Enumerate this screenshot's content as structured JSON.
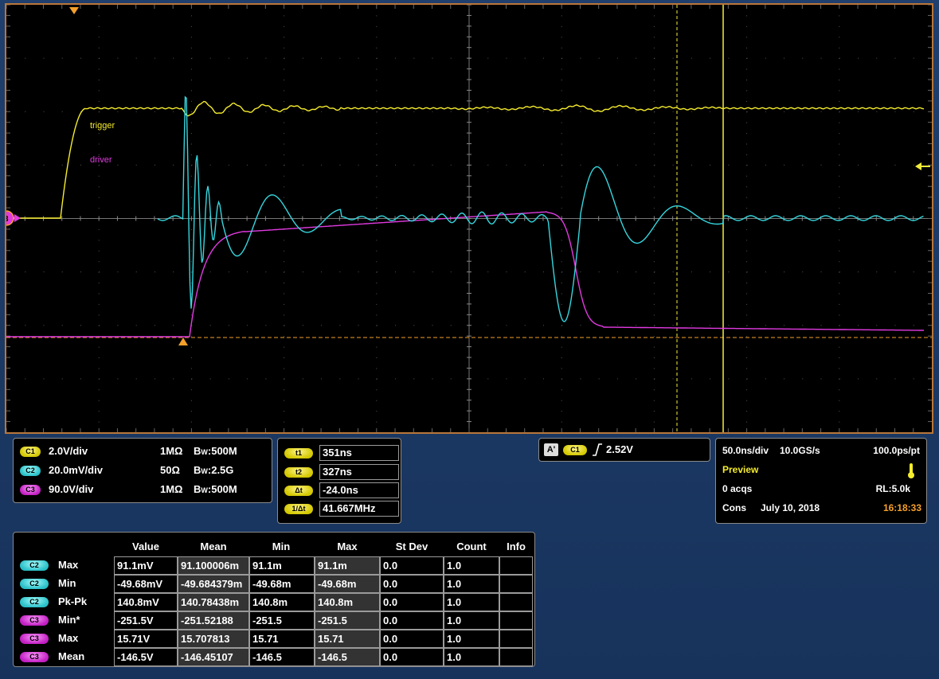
{
  "colors": {
    "ch1": "#f5ec2c",
    "ch2": "#35d6de",
    "ch3": "#e23ae2",
    "accent_orange": "#f5a02a",
    "cursor_line": "#f4ec3a"
  },
  "waveform_labels": {
    "ch1": "trigger",
    "ch3": "driver",
    "ground_marker": "3"
  },
  "vertical": [
    {
      "channel": "C1",
      "scale": "2.0V/div",
      "impedance": "1MΩ",
      "bw_b": "B",
      "bw_w": "W",
      "bw_value": ":500M"
    },
    {
      "channel": "C2",
      "scale": "20.0mV/div",
      "impedance": "50Ω",
      "bw_b": "B",
      "bw_w": "W",
      "bw_value": ":2.5G"
    },
    {
      "channel": "C3",
      "scale": "90.0V/div",
      "impedance": "1MΩ",
      "bw_b": "B",
      "bw_w": "W",
      "bw_value": ":500M"
    }
  ],
  "cursors": [
    {
      "label": "t1",
      "value": "351ns"
    },
    {
      "label": "t2",
      "value": "327ns"
    },
    {
      "label": "Δt",
      "value": "-24.0ns"
    },
    {
      "label": "1/Δt",
      "value": "41.667MHz"
    }
  ],
  "trigger": {
    "mode_badge": "A'",
    "source": "C1",
    "slope_icon": "rising-edge-icon",
    "level": "2.52V"
  },
  "acquisition": {
    "timebase": "50.0ns/div",
    "sample_rate": "10.0GS/s",
    "resolution": "100.0ps/pt",
    "state": "Preview",
    "acqs": "0 acqs",
    "record_length": "RL:5.0k",
    "cons": "Cons",
    "date": "July 10, 2018",
    "time": "16:18:33"
  },
  "measurements": {
    "headers": [
      "Value",
      "Mean",
      "Min",
      "Max",
      "St Dev",
      "Count",
      "Info"
    ],
    "rows": [
      {
        "channel": "C2",
        "name": "Max",
        "cells": [
          "91.1mV",
          "91.100006m",
          "91.1m",
          "91.1m",
          "0.0",
          "1.0",
          ""
        ]
      },
      {
        "channel": "C2",
        "name": "Min",
        "cells": [
          "-49.68mV",
          "-49.684379m",
          "-49.68m",
          "-49.68m",
          "0.0",
          "1.0",
          ""
        ]
      },
      {
        "channel": "C2",
        "name": "Pk-Pk",
        "cells": [
          "140.8mV",
          "140.78438m",
          "140.8m",
          "140.8m",
          "0.0",
          "1.0",
          ""
        ]
      },
      {
        "channel": "C3",
        "name": "Min*",
        "cells": [
          "-251.5V",
          "-251.52188",
          "-251.5",
          "-251.5",
          "0.0",
          "1.0",
          ""
        ]
      },
      {
        "channel": "C3",
        "name": "Max",
        "cells": [
          "15.71V",
          "15.707813",
          "15.71",
          "15.71",
          "0.0",
          "1.0",
          ""
        ]
      },
      {
        "channel": "C3",
        "name": "Mean",
        "cells": [
          "-146.5V",
          "-146.45107",
          "-146.5",
          "-146.5",
          "0.0",
          "1.0",
          ""
        ]
      }
    ]
  }
}
